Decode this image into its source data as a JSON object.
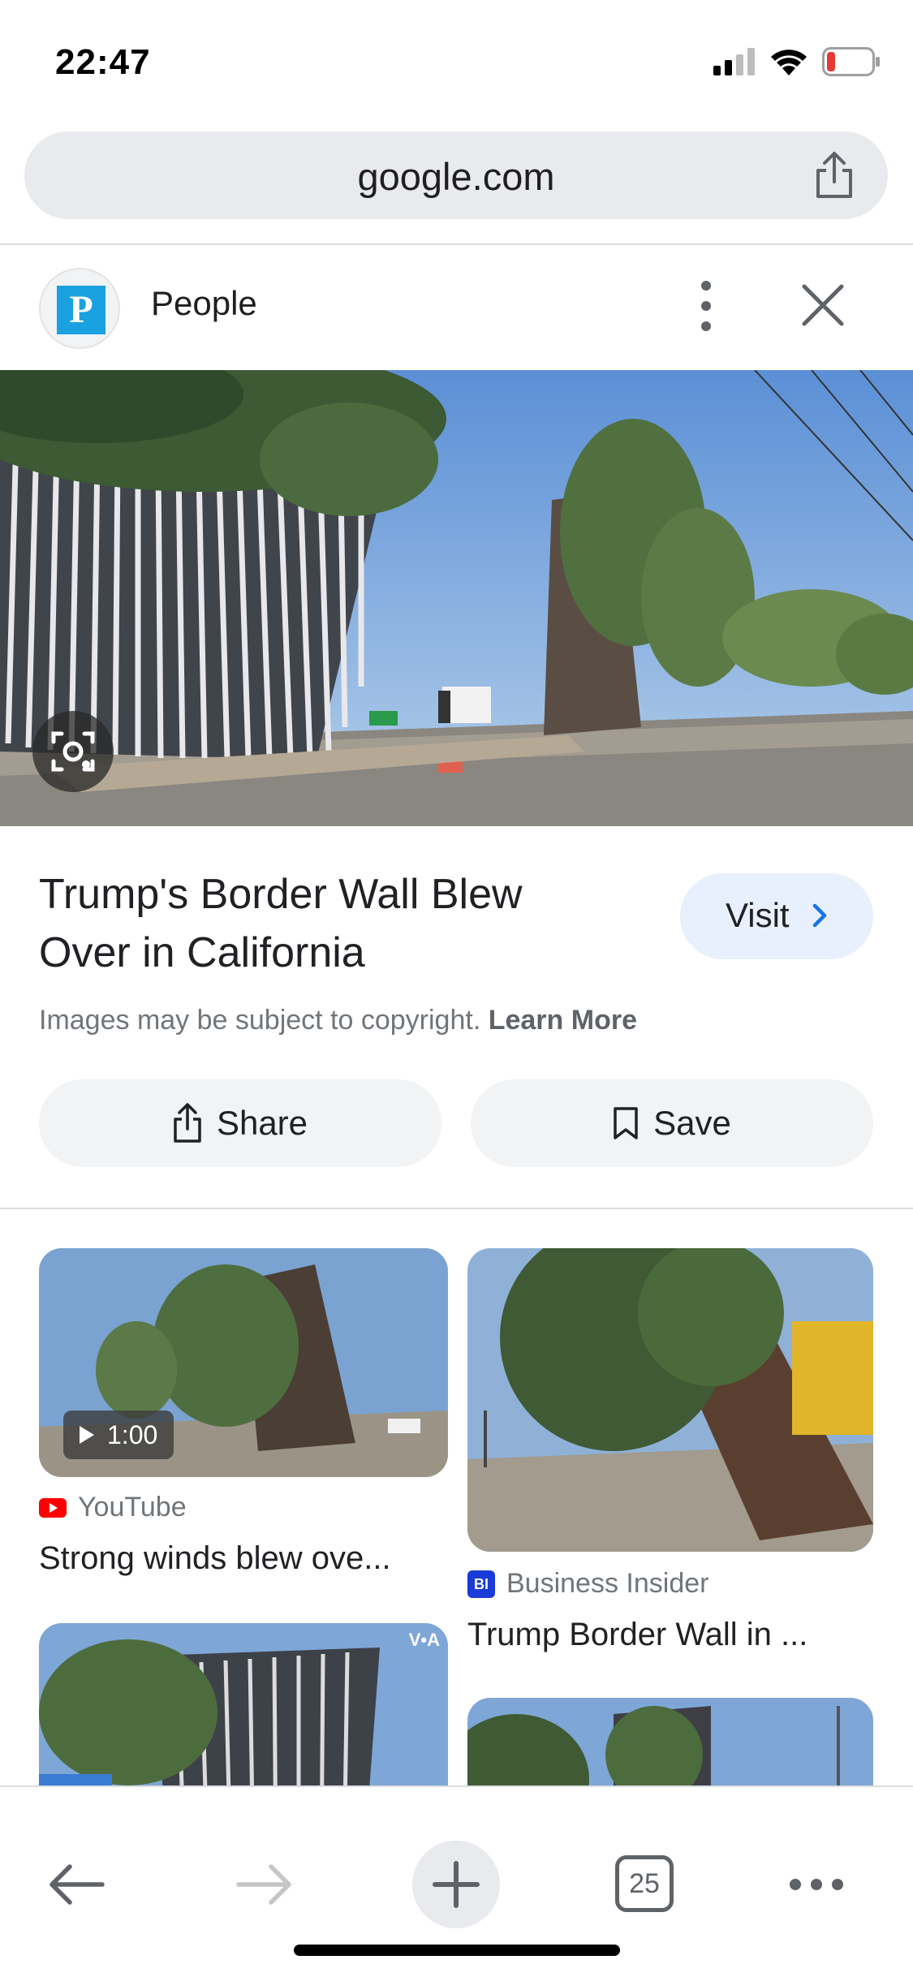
{
  "status_bar": {
    "time": "22:47",
    "battery_level": 0.15,
    "battery_color": "#e53935"
  },
  "url_bar": {
    "url": "google.com",
    "share_icon": "share-icon"
  },
  "source": {
    "avatar_letter": "P",
    "name": "People",
    "more_icon": "more-vertical-icon",
    "close_icon": "close-icon"
  },
  "main_image": {
    "description_icon": "lens-icon"
  },
  "result": {
    "title": "Trump's Border Wall Blew Over in California",
    "visit_label": "Visit",
    "copyright_text": "Images may be subject to copyright.",
    "learn_more": "Learn More",
    "share_label": "Share",
    "save_label": "Save"
  },
  "related": [
    {
      "duration": "1:00",
      "source": "YouTube",
      "title": "Strong winds blew ove..."
    },
    {
      "source": "Business Insider",
      "source_badge": "BI",
      "title": "Trump Border Wall in ..."
    },
    {
      "watermark": "V•A"
    },
    {}
  ],
  "toolbar": {
    "tab_count": "25"
  },
  "colors": {
    "accent": "#1a73e8",
    "visit_bg": "#e8f0fe",
    "youtube_red": "#ff0000",
    "bi_blue": "#1a3bd8"
  }
}
